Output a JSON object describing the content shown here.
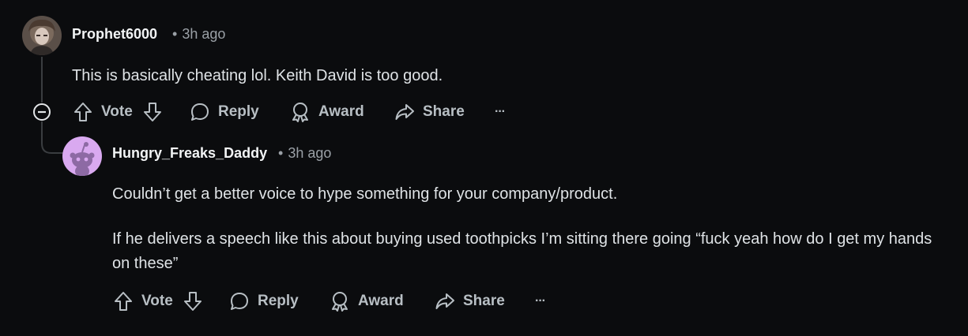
{
  "comments": [
    {
      "username": "Prophet6000",
      "time": "3h ago",
      "paragraphs": [
        "This is basically cheating lol. Keith David is too good."
      ],
      "actions": {
        "vote": "Vote",
        "reply": "Reply",
        "award": "Award",
        "share": "Share",
        "more": "···"
      }
    },
    {
      "username": "Hungry_Freaks_Daddy",
      "time": "3h ago",
      "paragraphs": [
        "Couldn’t get a better voice to hype something for your company/product.",
        "If he delivers a speech like this about buying used toothpicks I’m sitting there going “fuck yeah how do I get my hands on these”"
      ],
      "actions": {
        "vote": "Vote",
        "reply": "Reply",
        "award": "Award",
        "share": "Share",
        "more": "···"
      }
    }
  ],
  "icons": {
    "upvote": "arrow-up-icon",
    "downvote": "arrow-down-icon",
    "reply": "speech-bubble-icon",
    "award": "award-ribbon-icon",
    "share": "share-arrow-icon",
    "more": "ellipsis-icon",
    "collapse": "collapse-minus-icon"
  },
  "colors": {
    "background": "#0b0c0e",
    "text": "#dfe3e6",
    "muted": "#9aa0a6",
    "action": "#b8bfc4",
    "snoo_bg": "#d9a9f0"
  }
}
